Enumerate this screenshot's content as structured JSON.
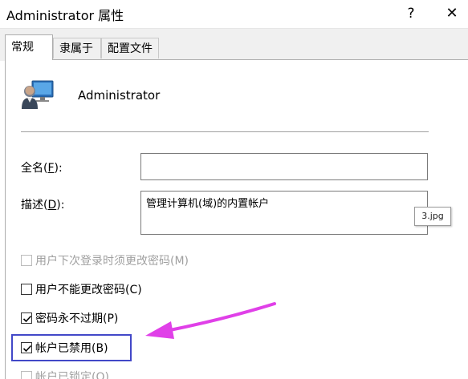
{
  "window": {
    "title": "Administrator 属性",
    "help_label": "?",
    "close_label": "✕"
  },
  "tabs": [
    {
      "label": "常规",
      "active": true
    },
    {
      "label": "隶属于",
      "active": false
    },
    {
      "label": "配置文件",
      "active": false
    }
  ],
  "general": {
    "user_icon": "user-account-icon",
    "username": "Administrator",
    "fullname": {
      "label_prefix": "全名(",
      "accel": "F",
      "label_suffix": "):",
      "value": ""
    },
    "description": {
      "label_prefix": "描述(",
      "accel": "D",
      "label_suffix": "):",
      "value": "管理计算机(域)的内置帐户"
    },
    "checkboxes": [
      {
        "text": "用户下次登录时须更改密码(M)",
        "checked": false,
        "disabled": true
      },
      {
        "text": "用户不能更改密码(C)",
        "checked": false,
        "disabled": false
      },
      {
        "text": "密码永不过期(P)",
        "checked": true,
        "disabled": false
      },
      {
        "text": "帐户已禁用(B)",
        "checked": true,
        "disabled": false
      },
      {
        "text": "帐户已锁定(O)",
        "checked": false,
        "disabled": true
      }
    ]
  },
  "annotation": {
    "image_tag": "3.jpg",
    "highlight_color": "#4248c8",
    "arrow_color": "#e040e8"
  }
}
